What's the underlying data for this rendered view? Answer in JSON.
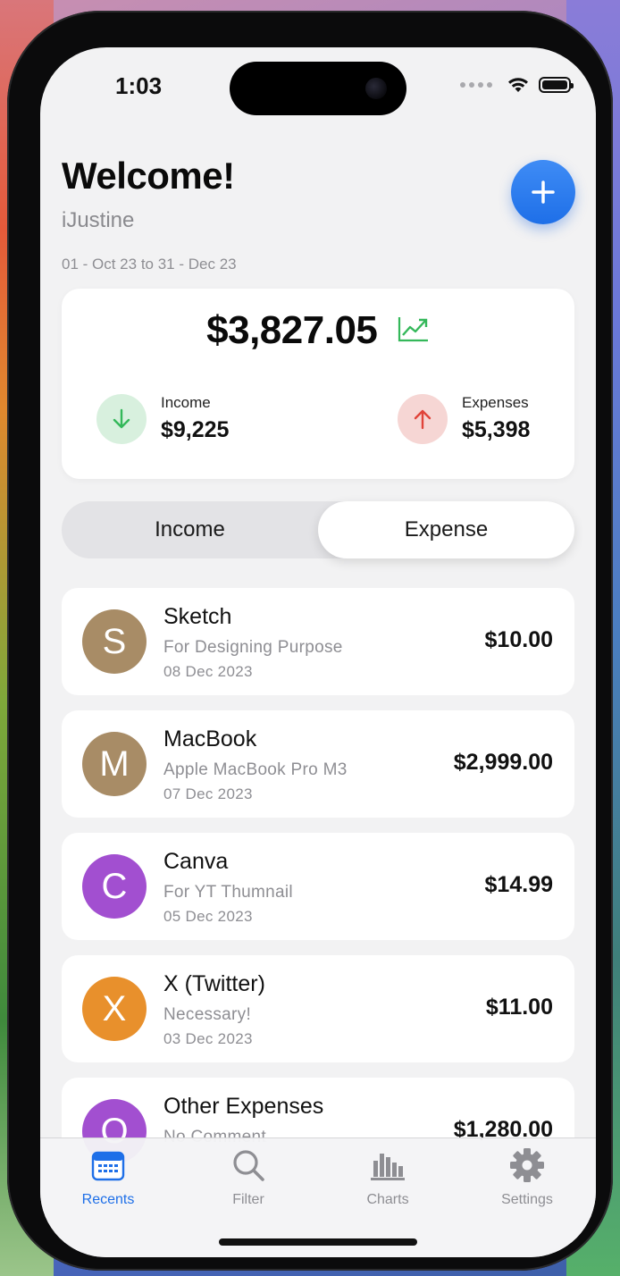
{
  "status_bar": {
    "time": "1:03"
  },
  "header": {
    "title": "Welcome!",
    "username": "iJustine",
    "date_range": "01 - Oct 23 to 31 - Dec 23"
  },
  "summary": {
    "balance": "$3,827.05",
    "income_label": "Income",
    "income_value": "$9,225",
    "expenses_label": "Expenses",
    "expenses_value": "$5,398"
  },
  "segment": {
    "income_label": "Income",
    "expense_label": "Expense",
    "selected": "Expense"
  },
  "transactions": [
    {
      "initial": "S",
      "title": "Sketch",
      "remark": "For Designing Purpose",
      "date": "08 Dec 2023",
      "amount": "$10.00",
      "color": "#a88c66"
    },
    {
      "initial": "M",
      "title": "MacBook",
      "remark": "Apple MacBook Pro M3",
      "date": "07 Dec 2023",
      "amount": "$2,999.00",
      "color": "#a88c66"
    },
    {
      "initial": "C",
      "title": "Canva",
      "remark": "For YT Thumnail",
      "date": "05 Dec 2023",
      "amount": "$14.99",
      "color": "#a24fd0"
    },
    {
      "initial": "X",
      "title": "X (Twitter)",
      "remark": "Necessary!",
      "date": "03 Dec 2023",
      "amount": "$11.00",
      "color": "#e8902c"
    },
    {
      "initial": "O",
      "title": "Other Expenses",
      "remark": "No Comment",
      "date": "",
      "amount": "$1,280.00",
      "color": "#a24fd0"
    }
  ],
  "tabbar": {
    "recents": "Recents",
    "filter": "Filter",
    "charts": "Charts",
    "settings": "Settings",
    "active": "Recents"
  },
  "colors": {
    "accent": "#1e6fe8",
    "income_green": "#34b85a",
    "expense_red": "#e0443a"
  }
}
